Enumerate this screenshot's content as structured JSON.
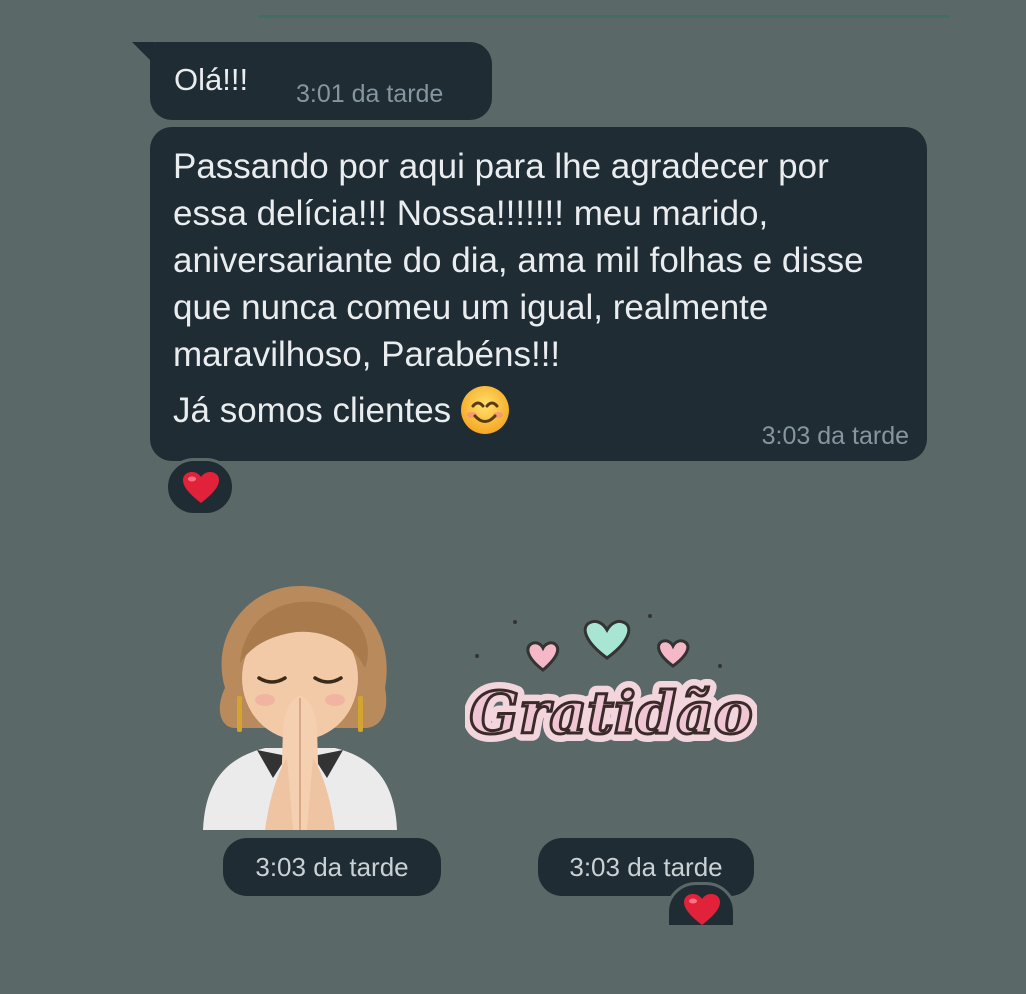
{
  "messages": [
    {
      "text": "Olá!!!",
      "time": "3:01 da tarde"
    },
    {
      "text_line1": "Passando por aqui para lhe agradecer por essa delícia!!! Nossa!!!!!!! meu marido, aniversariante do dia, ama mil folhas e disse que nunca comeu um igual, realmente maravilhoso, Parabéns!!!",
      "text_line2": "Já somos clientes",
      "emoji": "smiling-face-emoji",
      "time": "3:03 da tarde",
      "reaction": "red-heart"
    }
  ],
  "stickers": [
    {
      "name": "praying-avatar-sticker",
      "time": "3:03 da tarde"
    },
    {
      "name": "gratidao-sticker",
      "text": "Gratidão",
      "time": "3:03 da tarde",
      "reaction": "red-heart"
    }
  ],
  "colors": {
    "background": "#5a6868",
    "bubble": "#1f2c33",
    "timestamp": "#8696a0",
    "heart": "#e2213b"
  }
}
